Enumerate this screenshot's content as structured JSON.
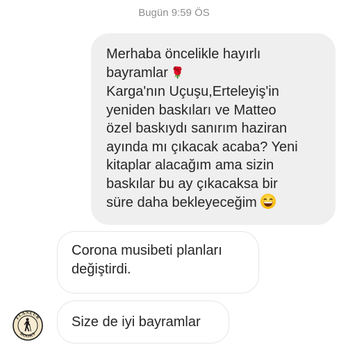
{
  "conversation": {
    "timestamp": "Bugün 9:59 ÖS"
  },
  "outgoing_message": {
    "lines": [
      "Merhaba öncelikle hayırlı",
      "bayramlar",
      "Karga'nın Uçuşu,Erteleyiş'in",
      "yeniden baskıları ve Matteo",
      "özel baskıydı sanırım haziran",
      "ayında mı çıkacak acaba? Yeni",
      "kitaplar alacağım ama sizin",
      "baskılar bu ay çıkacaksa bir",
      "süre daha bekleyeceğim"
    ],
    "emojis": [
      "rose-emoji",
      "grinning-face-emoji"
    ]
  },
  "incoming_messages": [
    {
      "lines": [
        "Corona musibeti planları",
        "değiştirdi."
      ]
    },
    {
      "lines": [
        "Size de iyi bayramlar"
      ]
    }
  ],
  "sender": {
    "avatar_icon": "flaneur-books-logo",
    "avatar_text_top": "FLANEUR",
    "avatar_text_bottom": "BOOKS"
  },
  "colors": {
    "outgoing_bubble": "#efefef",
    "incoming_border": "#e6e6e6",
    "text": "#262626",
    "timestamp": "#8e8e8e"
  }
}
